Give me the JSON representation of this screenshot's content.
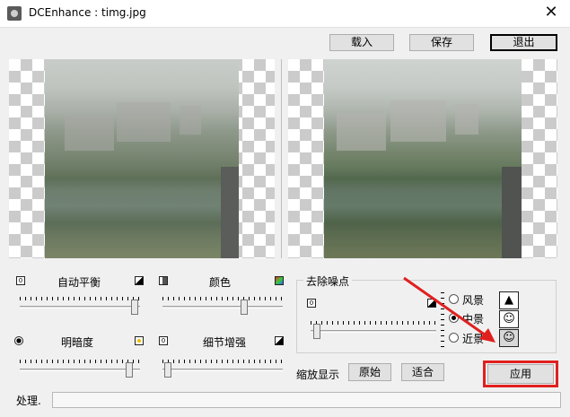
{
  "window": {
    "title": "DCEnhance : timg.jpg",
    "close_glyph": "✕"
  },
  "toolbar": {
    "load": "载入",
    "save": "保存",
    "exit": "退出"
  },
  "controls": {
    "auto_balance": "自动平衡",
    "color": "颜色",
    "brightness": "明暗度",
    "detail": "细节增强",
    "denoise": {
      "title": "去除噪点",
      "options": [
        "风景",
        "中景",
        "近景"
      ],
      "selected": "中景"
    }
  },
  "zoom": {
    "label": "缩放显示",
    "original": "原始",
    "fit": "适合"
  },
  "apply": "应用",
  "status": {
    "label": "处理."
  },
  "icons": {
    "landscape": "mountain-icon",
    "mid": "people-icon",
    "near": "face-icon"
  },
  "colors": {
    "highlight": "#e0201f"
  }
}
